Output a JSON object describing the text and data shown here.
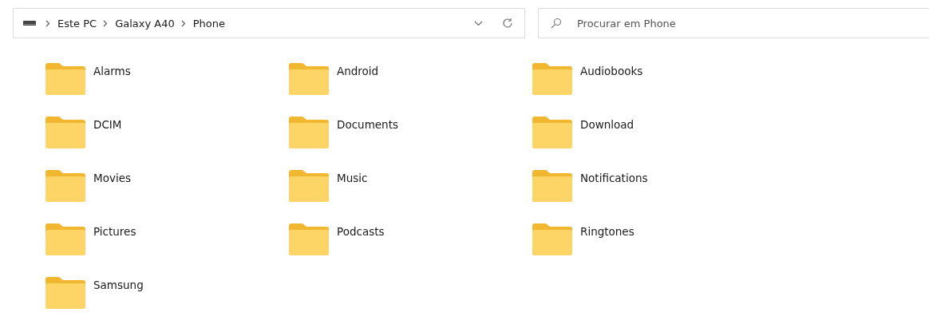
{
  "address_bar": {
    "breadcrumbs": [
      "Este PC",
      "Galaxy A40",
      "Phone"
    ]
  },
  "search": {
    "placeholder": "Procurar em Phone"
  },
  "folders": [
    {
      "name": "Alarms"
    },
    {
      "name": "Android"
    },
    {
      "name": "Audiobooks"
    },
    {
      "name": "DCIM"
    },
    {
      "name": "Documents"
    },
    {
      "name": "Download"
    },
    {
      "name": "Movies"
    },
    {
      "name": "Music"
    },
    {
      "name": "Notifications"
    },
    {
      "name": "Pictures"
    },
    {
      "name": "Podcasts"
    },
    {
      "name": "Ringtones"
    },
    {
      "name": "Samsung"
    }
  ]
}
